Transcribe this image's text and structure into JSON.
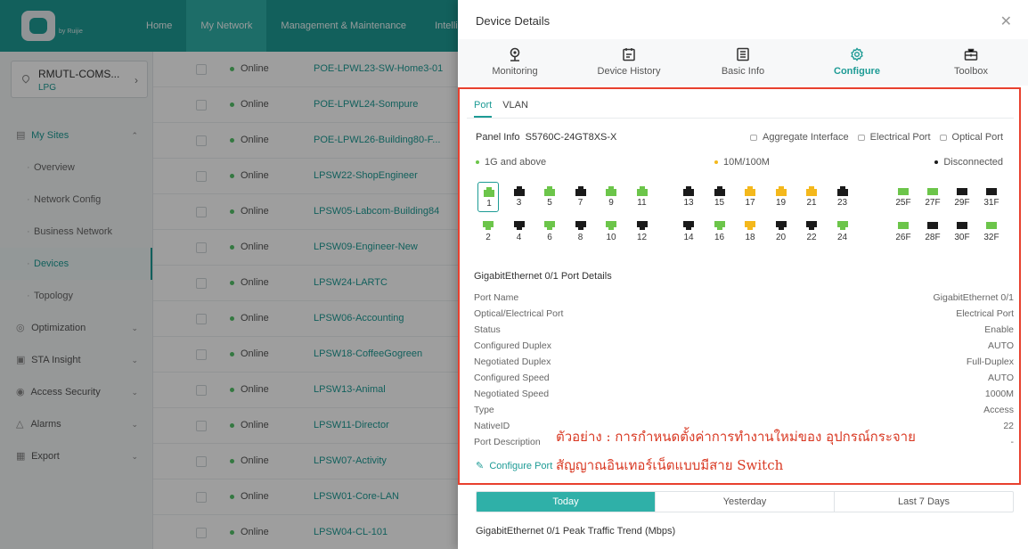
{
  "colors": {
    "brand": "#1d9b95",
    "online": "#55c26a",
    "port_1g": "#6cc54a",
    "port_10m100m": "#f4b81c",
    "port_disconnected": "#1a1a1a",
    "annotation": "#d93a24"
  },
  "logo": {
    "sub": "by Ruijie"
  },
  "topnav": {
    "items": [
      "Home",
      "My Network",
      "Management & Maintenance",
      "Intelligen"
    ]
  },
  "sidebar": {
    "site_name": "RMUTL-COMS...",
    "site_sub": "LPG",
    "items": [
      "My Sites",
      "Overview",
      "Network Config",
      "Business Network",
      "Devices",
      "Topology",
      "Optimization",
      "STA Insight",
      "Access Security",
      "Alarms",
      "Export"
    ]
  },
  "devices": {
    "status": "Online",
    "names": [
      "POE-LPWL23-SW-Home3-01",
      "POE-LPWL24-Sompure",
      "POE-LPWL26-Building80-F...",
      "LPSW22-ShopEngineer",
      "LPSW05-Labcom-Building84",
      "LPSW09-Engineer-New",
      "LPSW24-LARTC",
      "LPSW06-Accounting",
      "LPSW18-CoffeeGogreen",
      "LPSW13-Animal",
      "LPSW11-Director",
      "LPSW07-Activity",
      "LPSW01-Core-LAN",
      "LPSW04-CL-101"
    ]
  },
  "drawer": {
    "title": "Device Details",
    "close_icon": "close-icon",
    "tabs": [
      "Monitoring",
      "Device History",
      "Basic Info",
      "Configure",
      "Toolbox"
    ],
    "subtabs": [
      "Port",
      "VLAN"
    ],
    "panel_info_label": "Panel Info",
    "panel_model": "S5760C-24GT8XS-X",
    "port_types": [
      "Aggregate Interface",
      "Electrical Port",
      "Optical Port"
    ],
    "speed_legend": [
      "1G and above",
      "10M/100M",
      "Disconnected"
    ]
  },
  "ports": {
    "top": [
      {
        "n": "1",
        "s": "1g",
        "sel": true
      },
      {
        "n": "3",
        "s": "off"
      },
      {
        "n": "5",
        "s": "1g"
      },
      {
        "n": "7",
        "s": "off"
      },
      {
        "n": "9",
        "s": "1g"
      },
      {
        "n": "11",
        "s": "1g"
      },
      {
        "n": "13",
        "s": "off"
      },
      {
        "n": "15",
        "s": "off"
      },
      {
        "n": "17",
        "s": "m"
      },
      {
        "n": "19",
        "s": "m"
      },
      {
        "n": "21",
        "s": "m"
      },
      {
        "n": "23",
        "s": "off"
      },
      {
        "n": "25F",
        "s": "1g"
      },
      {
        "n": "27F",
        "s": "1g"
      },
      {
        "n": "29F",
        "s": "off"
      },
      {
        "n": "31F",
        "s": "off"
      }
    ],
    "bottom": [
      {
        "n": "2",
        "s": "1g"
      },
      {
        "n": "4",
        "s": "off"
      },
      {
        "n": "6",
        "s": "1g"
      },
      {
        "n": "8",
        "s": "off"
      },
      {
        "n": "10",
        "s": "1g"
      },
      {
        "n": "12",
        "s": "off"
      },
      {
        "n": "14",
        "s": "off"
      },
      {
        "n": "16",
        "s": "1g"
      },
      {
        "n": "18",
        "s": "m"
      },
      {
        "n": "20",
        "s": "off"
      },
      {
        "n": "22",
        "s": "off"
      },
      {
        "n": "24",
        "s": "1g"
      },
      {
        "n": "26F",
        "s": "1g"
      },
      {
        "n": "28F",
        "s": "off"
      },
      {
        "n": "30F",
        "s": "off"
      },
      {
        "n": "32F",
        "s": "1g"
      }
    ]
  },
  "port_details": {
    "title": "GigabitEthernet 0/1 Port Details",
    "rows": [
      {
        "label": "Port Name",
        "value": "GigabitEthernet 0/1"
      },
      {
        "label": "Optical/Electrical Port",
        "value": "Electrical Port"
      },
      {
        "label": "Status",
        "value": "Enable"
      },
      {
        "label": "Configured Duplex",
        "value": "AUTO"
      },
      {
        "label": "Negotiated Duplex",
        "value": "Full-Duplex"
      },
      {
        "label": "Configured Speed",
        "value": "AUTO"
      },
      {
        "label": "Negotiated Speed",
        "value": "1000M"
      },
      {
        "label": "Type",
        "value": "Access"
      },
      {
        "label": "NativeID",
        "value": "22"
      },
      {
        "label": "Port Description",
        "value": "-"
      }
    ],
    "configure_label": "Configure Port"
  },
  "annotation": {
    "line1": "ตัวอย่าง : การกำหนดตั้งค่าการทำงานใหม่ของ อุปกรณ์กระจาย",
    "line2": "สัญญาณอินเทอร์เน็ตแบบมีสาย Switch"
  },
  "traffic": {
    "day_tabs": [
      "Today",
      "Yesterday",
      "Last 7 Days"
    ],
    "title": "GigabitEthernet 0/1 Peak Traffic Trend  (Mbps)"
  }
}
